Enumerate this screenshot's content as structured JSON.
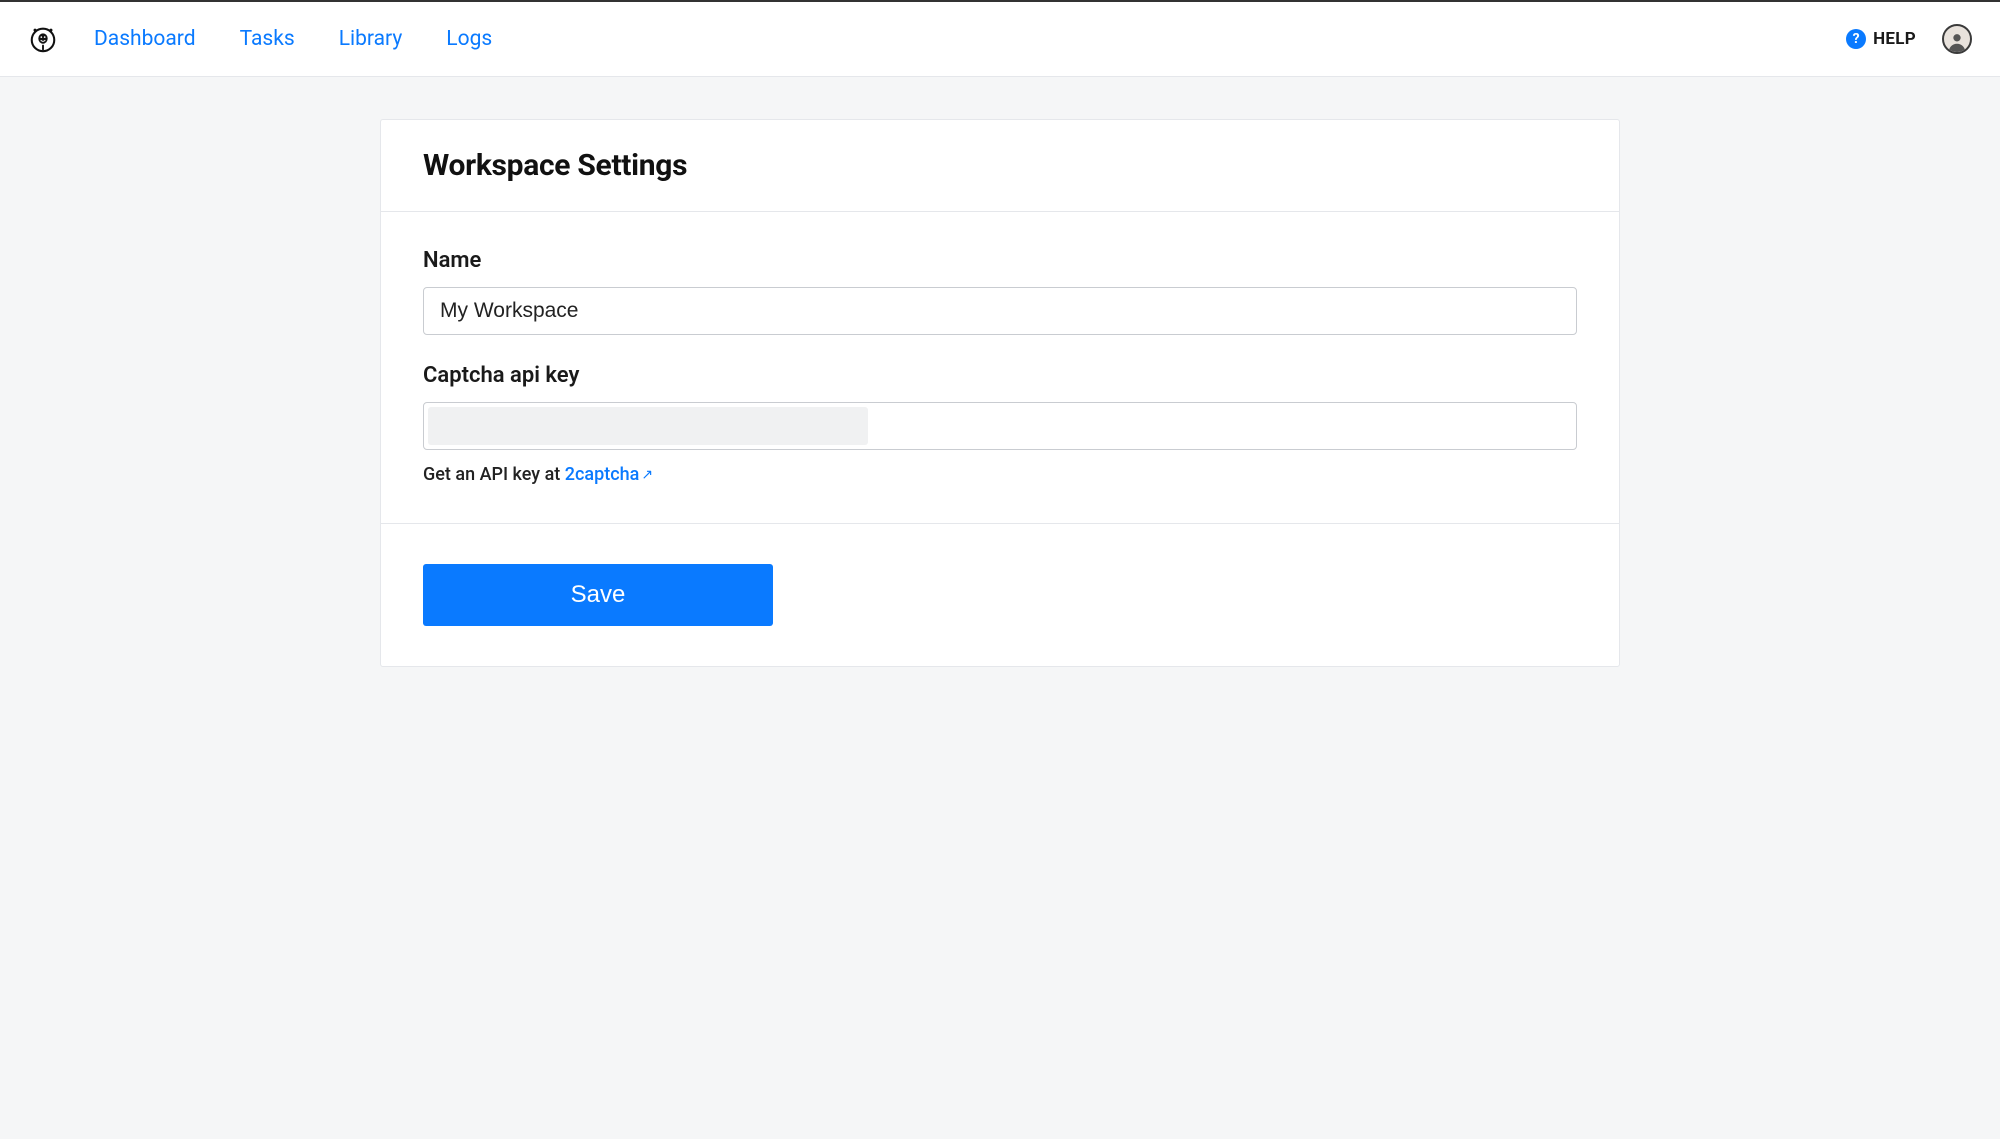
{
  "nav": {
    "items": [
      {
        "label": "Dashboard"
      },
      {
        "label": "Tasks"
      },
      {
        "label": "Library"
      },
      {
        "label": "Logs"
      }
    ],
    "help_label": "HELP"
  },
  "page": {
    "title": "Workspace Settings"
  },
  "form": {
    "name": {
      "label": "Name",
      "value": "My Workspace"
    },
    "captcha": {
      "label": "Captcha api key",
      "value": "",
      "helper_prefix": "Get an API key at ",
      "link_text": "2captcha"
    },
    "save_label": "Save"
  }
}
